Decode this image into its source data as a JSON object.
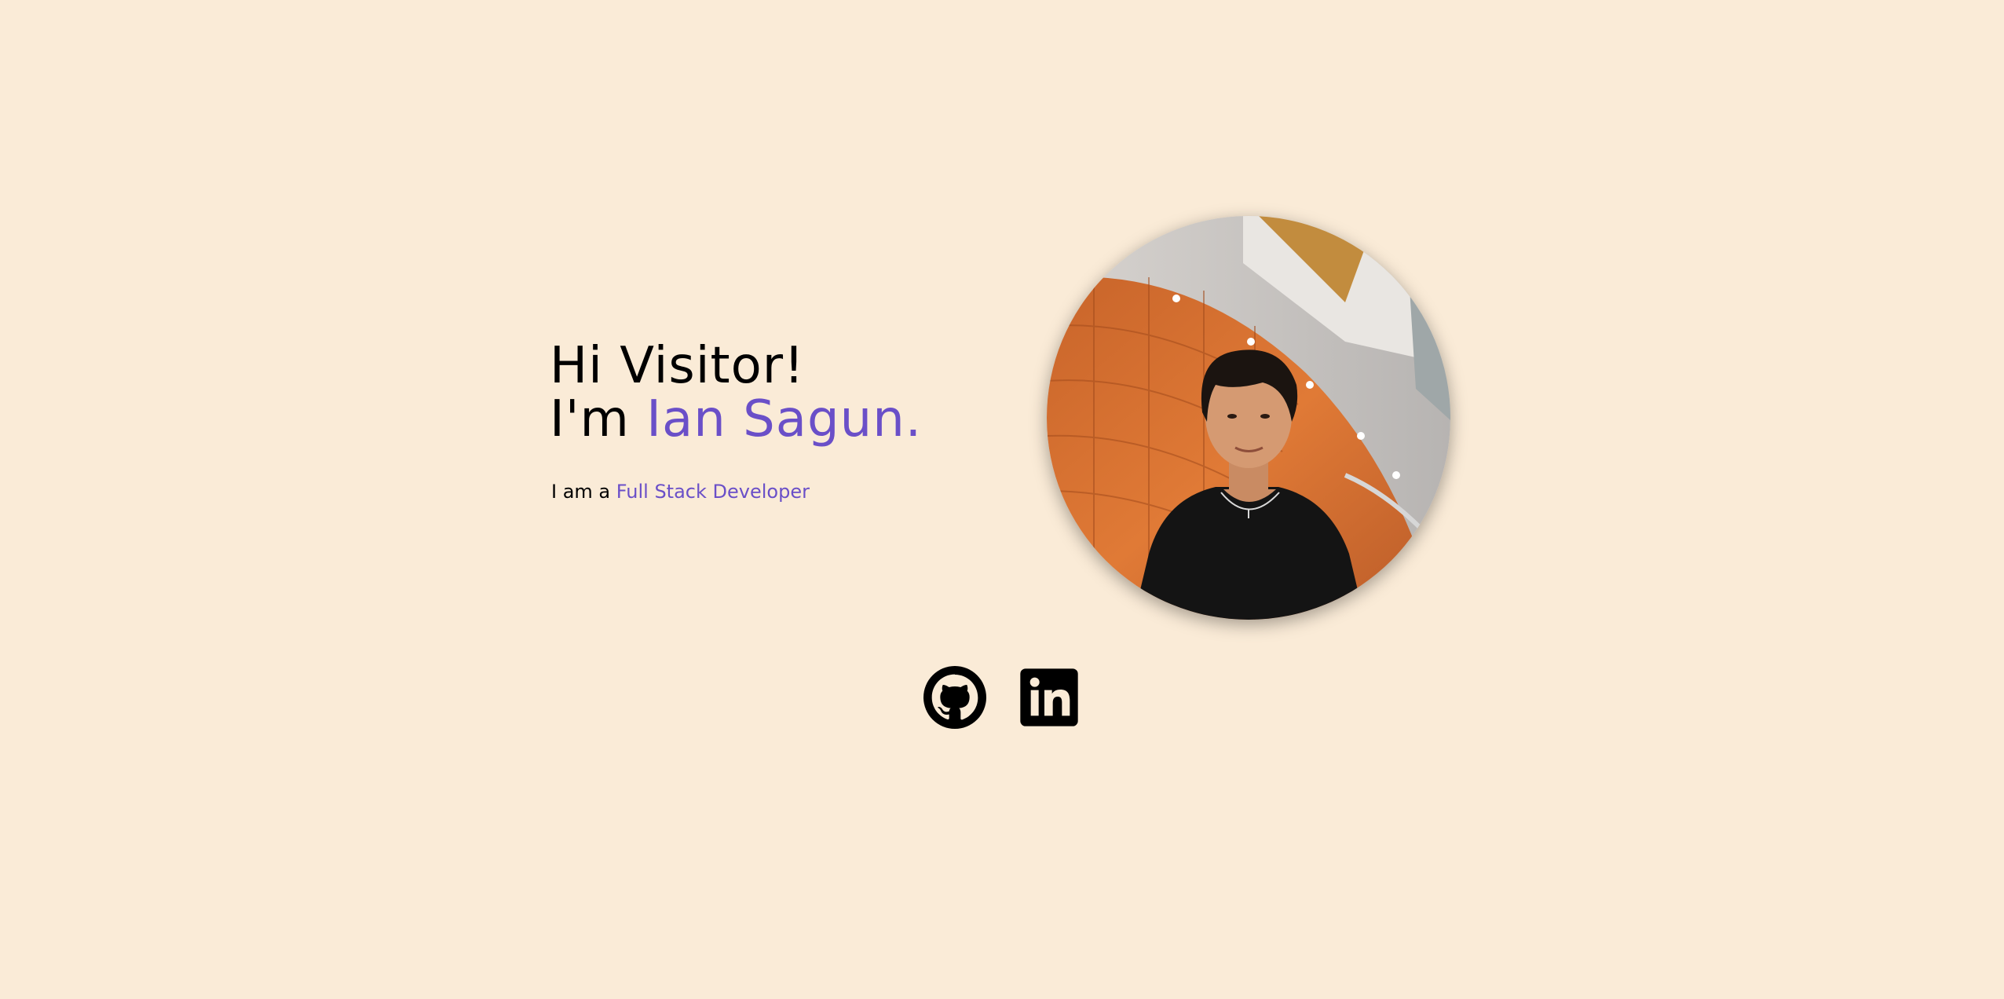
{
  "hero": {
    "greeting": "Hi Visitor!",
    "name_prefix": "I'm",
    "name": "Ian Sagun.",
    "role_prefix": "I am a",
    "role": "Full Stack Developer"
  },
  "portrait": {
    "alt": "Ian Sagun"
  },
  "socials": [
    {
      "name": "GitHub",
      "icon": "github-icon"
    },
    {
      "name": "LinkedIn",
      "icon": "linkedin-icon"
    }
  ],
  "colors": {
    "background": "#faebd7",
    "accent": "#6a4fc8",
    "text": "#000000"
  }
}
